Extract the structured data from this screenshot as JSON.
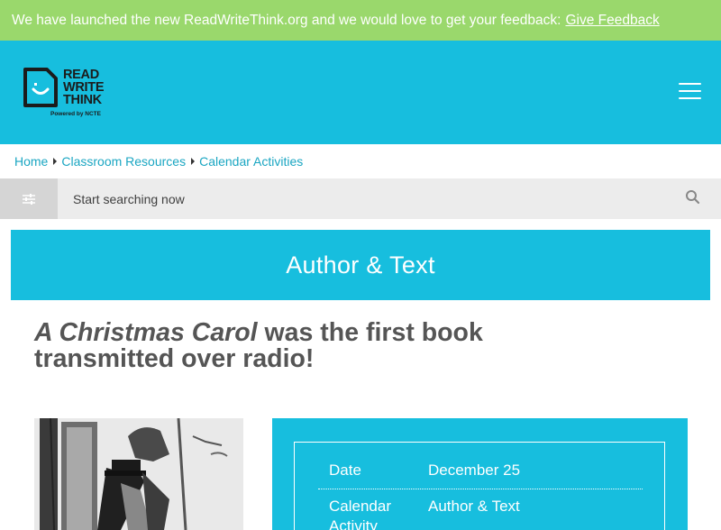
{
  "banner": {
    "message": "We have launched the new ReadWriteThink.org and we would love to get your feedback:",
    "link_label": "Give Feedback"
  },
  "header": {
    "logo": {
      "line1": "READ",
      "line2": "WRITE",
      "line3": "THINK",
      "tagline": "Powered by NCTE"
    },
    "menu_icon": "hamburger-icon"
  },
  "breadcrumb": {
    "items": [
      "Home",
      "Classroom Resources",
      "Calendar Activities"
    ]
  },
  "search": {
    "placeholder": "Start searching now",
    "filter_icon": "filter-sliders-icon",
    "search_icon": "magnifier-icon"
  },
  "page": {
    "category_title": "Author & Text",
    "headline_italic": "A Christmas Carol",
    "headline_rest": " was the first book transmitted over radio!"
  },
  "info": {
    "rows": [
      {
        "label": "Date",
        "value": "December 25"
      },
      {
        "label": "Calendar Activity",
        "value": "Author & Text"
      }
    ]
  },
  "colors": {
    "banner_green": "#9ad86c",
    "brand_cyan": "#17bede",
    "breadcrumb_link": "#1aa6c2",
    "headline_gray": "#555555"
  }
}
